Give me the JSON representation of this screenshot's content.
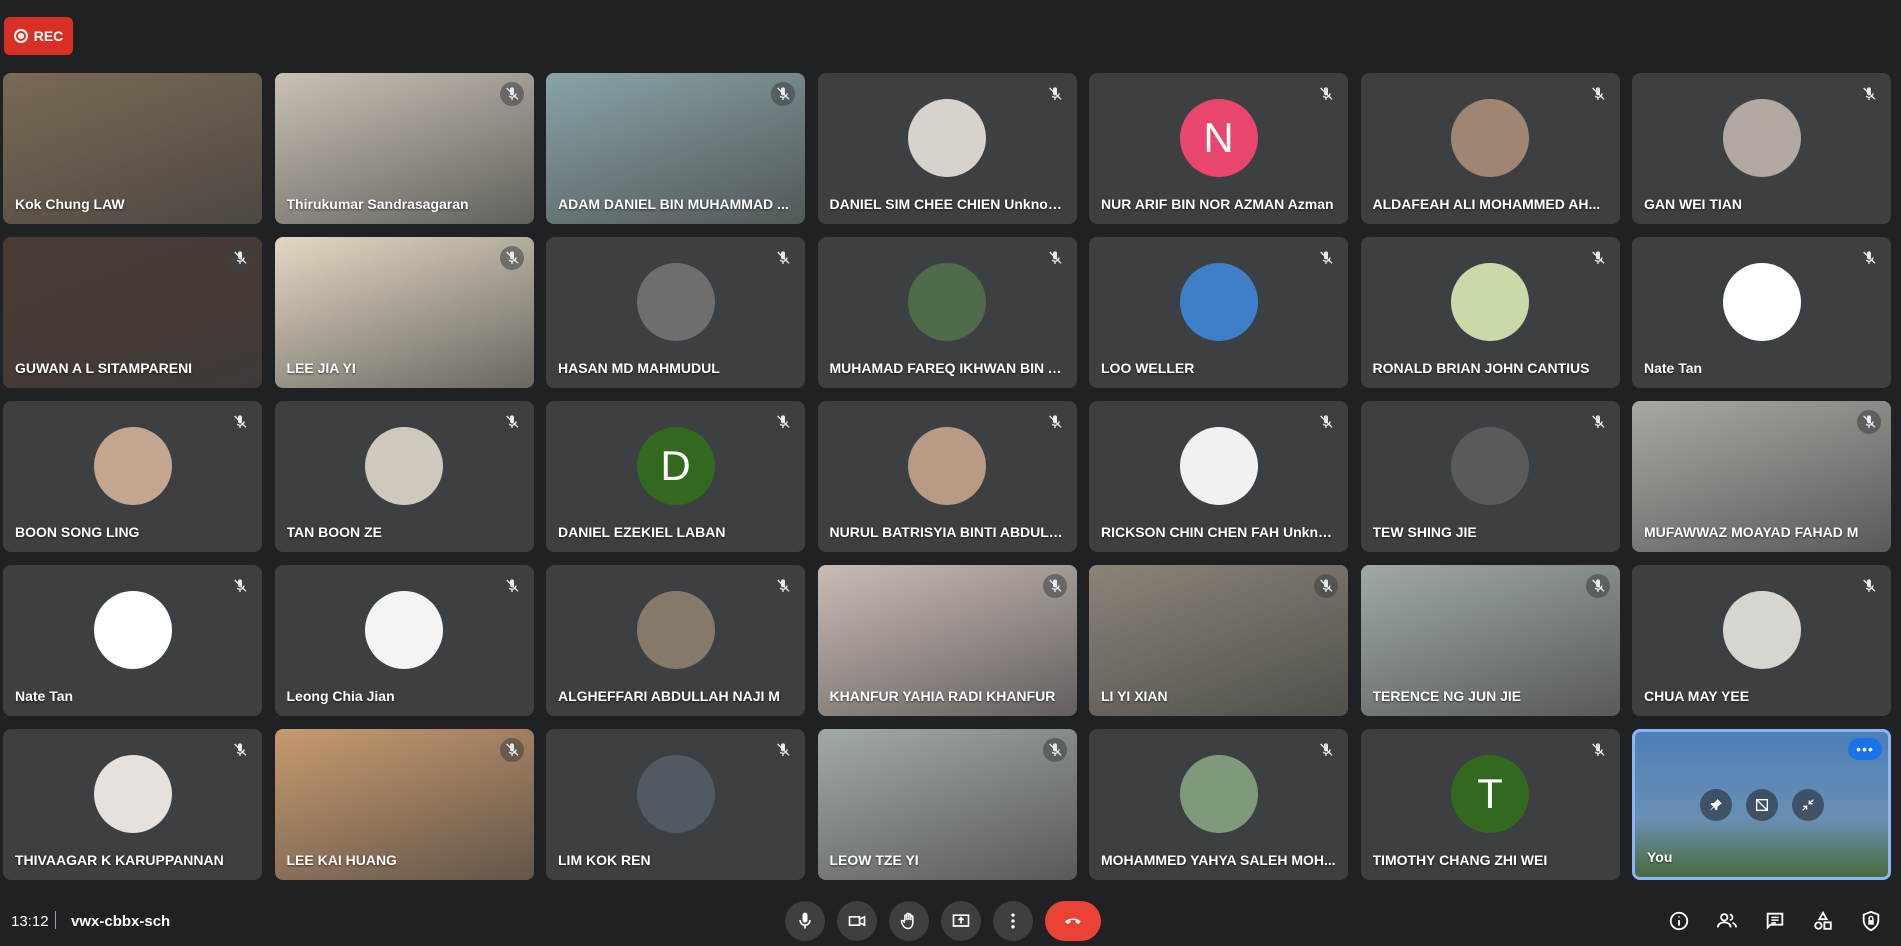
{
  "recording": {
    "label": "REC"
  },
  "participants": [
    {
      "name": "Kok Chung LAW",
      "type": "video",
      "muted": false,
      "bg": "#7a6a55"
    },
    {
      "name": "Thirukumar Sandrasagaran",
      "type": "video",
      "muted": true,
      "bg": "#c9c1b4"
    },
    {
      "name": "ADAM DANIEL BIN MUHAMMAD ...",
      "type": "video",
      "muted": true,
      "bg": "#8aa3a6"
    },
    {
      "name": "DANIEL SIM CHEE CHIEN Unknown",
      "type": "avatar",
      "muted": true,
      "avatar_color": "#d7d2cc"
    },
    {
      "name": "NUR ARIF BIN NOR AZMAN Azman",
      "type": "letter",
      "letter": "N",
      "muted": true,
      "avatar_color": "#e8466d"
    },
    {
      "name": "ALDAFEAH ALI MOHAMMED AH...",
      "type": "avatar",
      "muted": true,
      "avatar_color": "#a08570"
    },
    {
      "name": "GAN WEI TIAN",
      "type": "avatar",
      "muted": true,
      "avatar_color": "#b2a89f"
    },
    {
      "name": "GUWAN A L SITAMPARENI",
      "type": "video",
      "muted": true,
      "bg": "#4b3a33"
    },
    {
      "name": "LEE JIA YI",
      "type": "video",
      "muted": true,
      "bg": "#e2d8c3"
    },
    {
      "name": "HASAN MD MAHMUDUL",
      "type": "avatar",
      "muted": true,
      "avatar_color": "#6e6e6e"
    },
    {
      "name": "MUHAMAD FAREQ IKHWAN BIN A...",
      "type": "avatar",
      "muted": true,
      "avatar_color": "#4f6b4a"
    },
    {
      "name": "LOO WELLER",
      "type": "avatar",
      "muted": true,
      "avatar_color": "#3f7fc8"
    },
    {
      "name": "RONALD BRIAN JOHN CANTIUS",
      "type": "avatar",
      "muted": true,
      "avatar_color": "#c9d9a7"
    },
    {
      "name": "Nate Tan",
      "type": "avatar",
      "muted": true,
      "avatar_color": "#ffffff"
    },
    {
      "name": "BOON SONG LING",
      "type": "avatar",
      "muted": true,
      "avatar_color": "#c4a58d"
    },
    {
      "name": "TAN BOON ZE",
      "type": "avatar",
      "muted": true,
      "avatar_color": "#cfc8bd"
    },
    {
      "name": "DANIEL EZEKIEL LABAN",
      "type": "letter",
      "letter": "D",
      "muted": true,
      "avatar_color": "#33691e"
    },
    {
      "name": "NURUL BATRISYIA BINTI ABDUL A...",
      "type": "avatar",
      "muted": true,
      "avatar_color": "#b99a85"
    },
    {
      "name": "RICKSON CHIN CHEN FAH Unkno...",
      "type": "avatar",
      "muted": true,
      "avatar_color": "#f1f1f1"
    },
    {
      "name": "TEW SHING JIE",
      "type": "avatar",
      "muted": true,
      "avatar_color": "#5a5a5a"
    },
    {
      "name": "MUFAWWAZ MOAYAD FAHAD M",
      "type": "video",
      "muted": true,
      "bg": "#a9a9a3"
    },
    {
      "name": "Nate Tan",
      "type": "avatar",
      "muted": true,
      "avatar_color": "#ffffff"
    },
    {
      "name": "Leong Chia Jian",
      "type": "avatar",
      "muted": true,
      "avatar_color": "#f4f4f4"
    },
    {
      "name": "ALGHEFFARI ABDULLAH NAJI M",
      "type": "avatar",
      "muted": true,
      "avatar_color": "#86796a"
    },
    {
      "name": "KHANFUR YAHIA RADI KHANFUR",
      "type": "video",
      "muted": true,
      "bg": "#c9bcb6"
    },
    {
      "name": "LI YI XIAN",
      "type": "video",
      "muted": true,
      "bg": "#8b8478"
    },
    {
      "name": "TERENCE NG JUN JIE",
      "type": "video",
      "muted": true,
      "bg": "#9fa9a8"
    },
    {
      "name": "CHUA MAY YEE",
      "type": "avatar",
      "muted": true,
      "avatar_color": "#d8d4cf"
    },
    {
      "name": "THIVAAGAR K KARUPPANNAN",
      "type": "avatar",
      "muted": true,
      "avatar_color": "#e6e1dc"
    },
    {
      "name": "LEE KAI HUANG",
      "type": "video",
      "muted": true,
      "bg": "#c89a6f"
    },
    {
      "name": "LIM KOK REN",
      "type": "avatar",
      "muted": true,
      "avatar_color": "#4f5a63"
    },
    {
      "name": "LEOW TZE YI",
      "type": "video",
      "muted": true,
      "bg": "#a2aaa9"
    },
    {
      "name": "MOHAMMED YAHYA SALEH MOH...",
      "type": "avatar",
      "muted": true,
      "avatar_color": "#7f9a7a"
    },
    {
      "name": "TIMOTHY CHANG ZHI WEI",
      "type": "letter",
      "letter": "T",
      "muted": true,
      "avatar_color": "#33691e"
    },
    {
      "name": "You",
      "type": "self",
      "muted": false,
      "bg": "#4b7fb8"
    }
  ],
  "self_tile": {
    "more_label": "•••"
  },
  "footer": {
    "time": "13:12",
    "meeting_code": "vwx-cbbx-sch"
  },
  "colors": {
    "end_call": "#ea4335",
    "accent": "#8ab4f8",
    "rec": "#d93025"
  }
}
